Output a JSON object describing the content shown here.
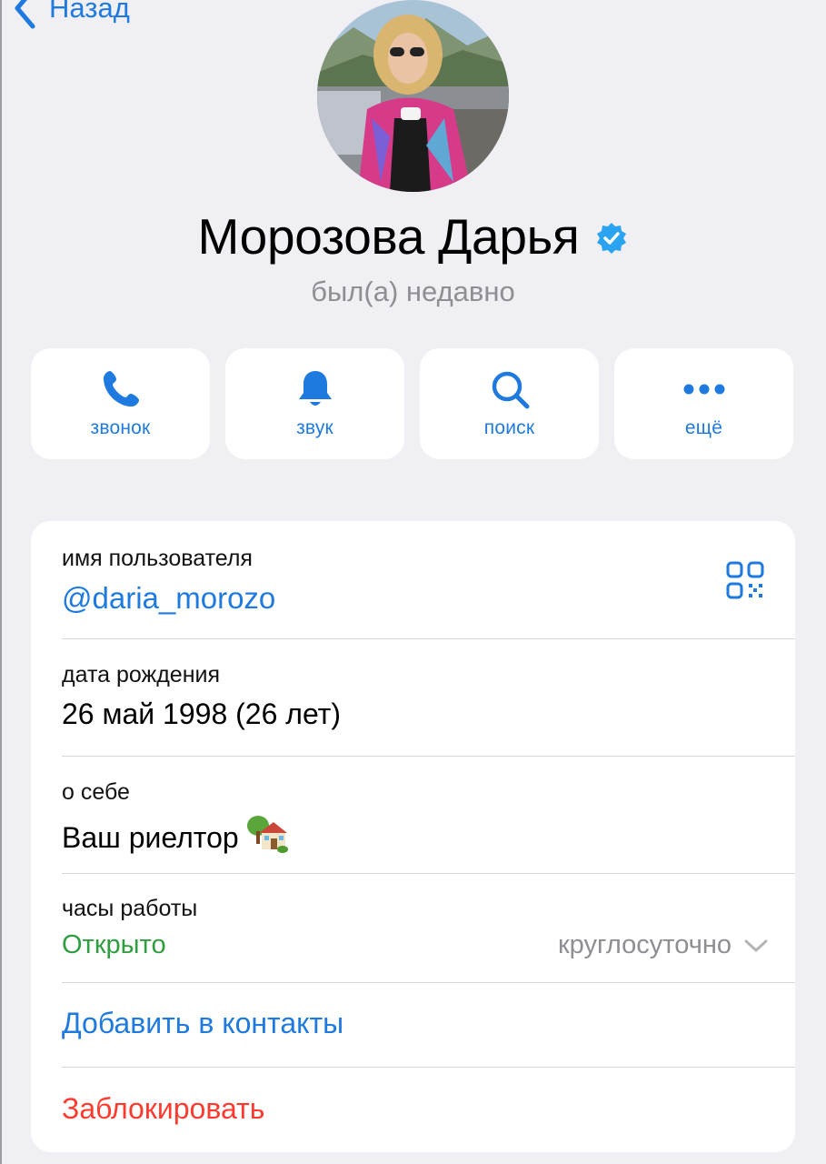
{
  "nav": {
    "back_label": "Назад"
  },
  "profile": {
    "name": "Морозова Дарья",
    "status": "был(а) недавно",
    "verified": true
  },
  "actions": [
    {
      "label": "звонок",
      "icon": "phone-icon"
    },
    {
      "label": "звук",
      "icon": "bell-icon"
    },
    {
      "label": "поиск",
      "icon": "search-icon"
    },
    {
      "label": "ещё",
      "icon": "more-icon"
    }
  ],
  "info": {
    "username_label": "имя пользователя",
    "username_value": "@daria_morozo",
    "birthday_label": "дата рождения",
    "birthday_value": "26 май 1998 (26 лет)",
    "bio_label": "о себе",
    "bio_value": "Ваш риелтор",
    "bio_emoji": "house-with-garden-icon",
    "hours_label": "часы работы",
    "hours_status": "Открыто",
    "hours_value": "круглосуточно"
  },
  "contact_actions": {
    "add_contact": "Добавить в контакты",
    "block": "Заблокировать"
  },
  "colors": {
    "accent": "#1f7ae0",
    "background": "#efeff4",
    "open_green": "#2e9e3e",
    "destructive_red": "#ff3b30",
    "secondary_gray": "#8e8e93",
    "verified_badge": "#2aa3f0"
  }
}
